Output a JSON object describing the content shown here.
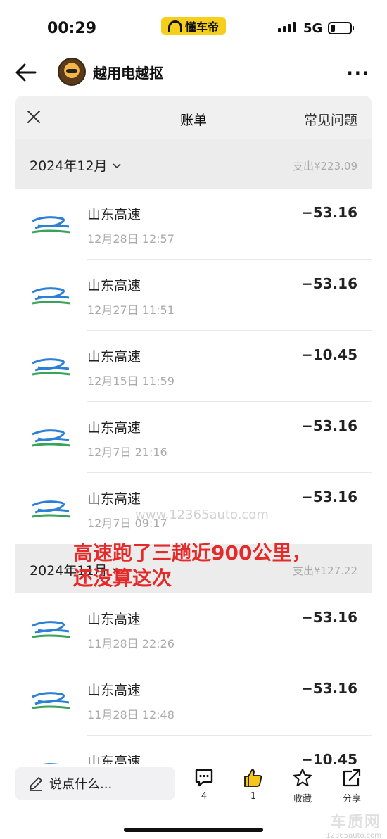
{
  "status_bar": {
    "time": "00:29",
    "app_badge": "懂车帝",
    "network": "5G"
  },
  "nav": {
    "title": "越用电越抠",
    "more": "···"
  },
  "sheet": {
    "title": "账单",
    "faq": "常见问题"
  },
  "months": [
    {
      "label": "2024年12月",
      "total": "支出¥223.09",
      "items": [
        {
          "name": "山东高速",
          "time": "12月28日 12:57",
          "amount": "−53.16"
        },
        {
          "name": "山东高速",
          "time": "12月27日 11:51",
          "amount": "−53.16"
        },
        {
          "name": "山东高速",
          "time": "12月15日 11:59",
          "amount": "−10.45"
        },
        {
          "name": "山东高速",
          "time": "12月7日 21:16",
          "amount": "−53.16"
        },
        {
          "name": "山东高速",
          "time": "12月7日 09:17",
          "amount": "−53.16"
        }
      ]
    },
    {
      "label": "2024年11月",
      "total": "支出¥127.22",
      "items": [
        {
          "name": "山东高速",
          "time": "11月28日 22:26",
          "amount": "−53.16"
        },
        {
          "name": "山东高速",
          "time": "11月28日 12:48",
          "amount": "−53.16"
        },
        {
          "name": "山东高速",
          "time": "",
          "amount": "−10.45"
        }
      ]
    }
  ],
  "watermark": "www.12365auto.com",
  "annotation": {
    "line1": "高速跑了三趟近900公里，",
    "line2": "还没算这次"
  },
  "bottom_bar": {
    "comment_placeholder": "说点什么...",
    "comment_count": "4",
    "like_count": "1",
    "favorite_label": "收藏",
    "share_label": "分享"
  },
  "corner_logo": {
    "name": "车质网",
    "url": "12365auto.com"
  },
  "colors": {
    "accent_yellow": "#f6cf1c",
    "like_yellow": "#f5c518",
    "annotation_red": "#e52a2a",
    "logo_blue": "#2b7fd4",
    "logo_green": "#3aa35a"
  }
}
